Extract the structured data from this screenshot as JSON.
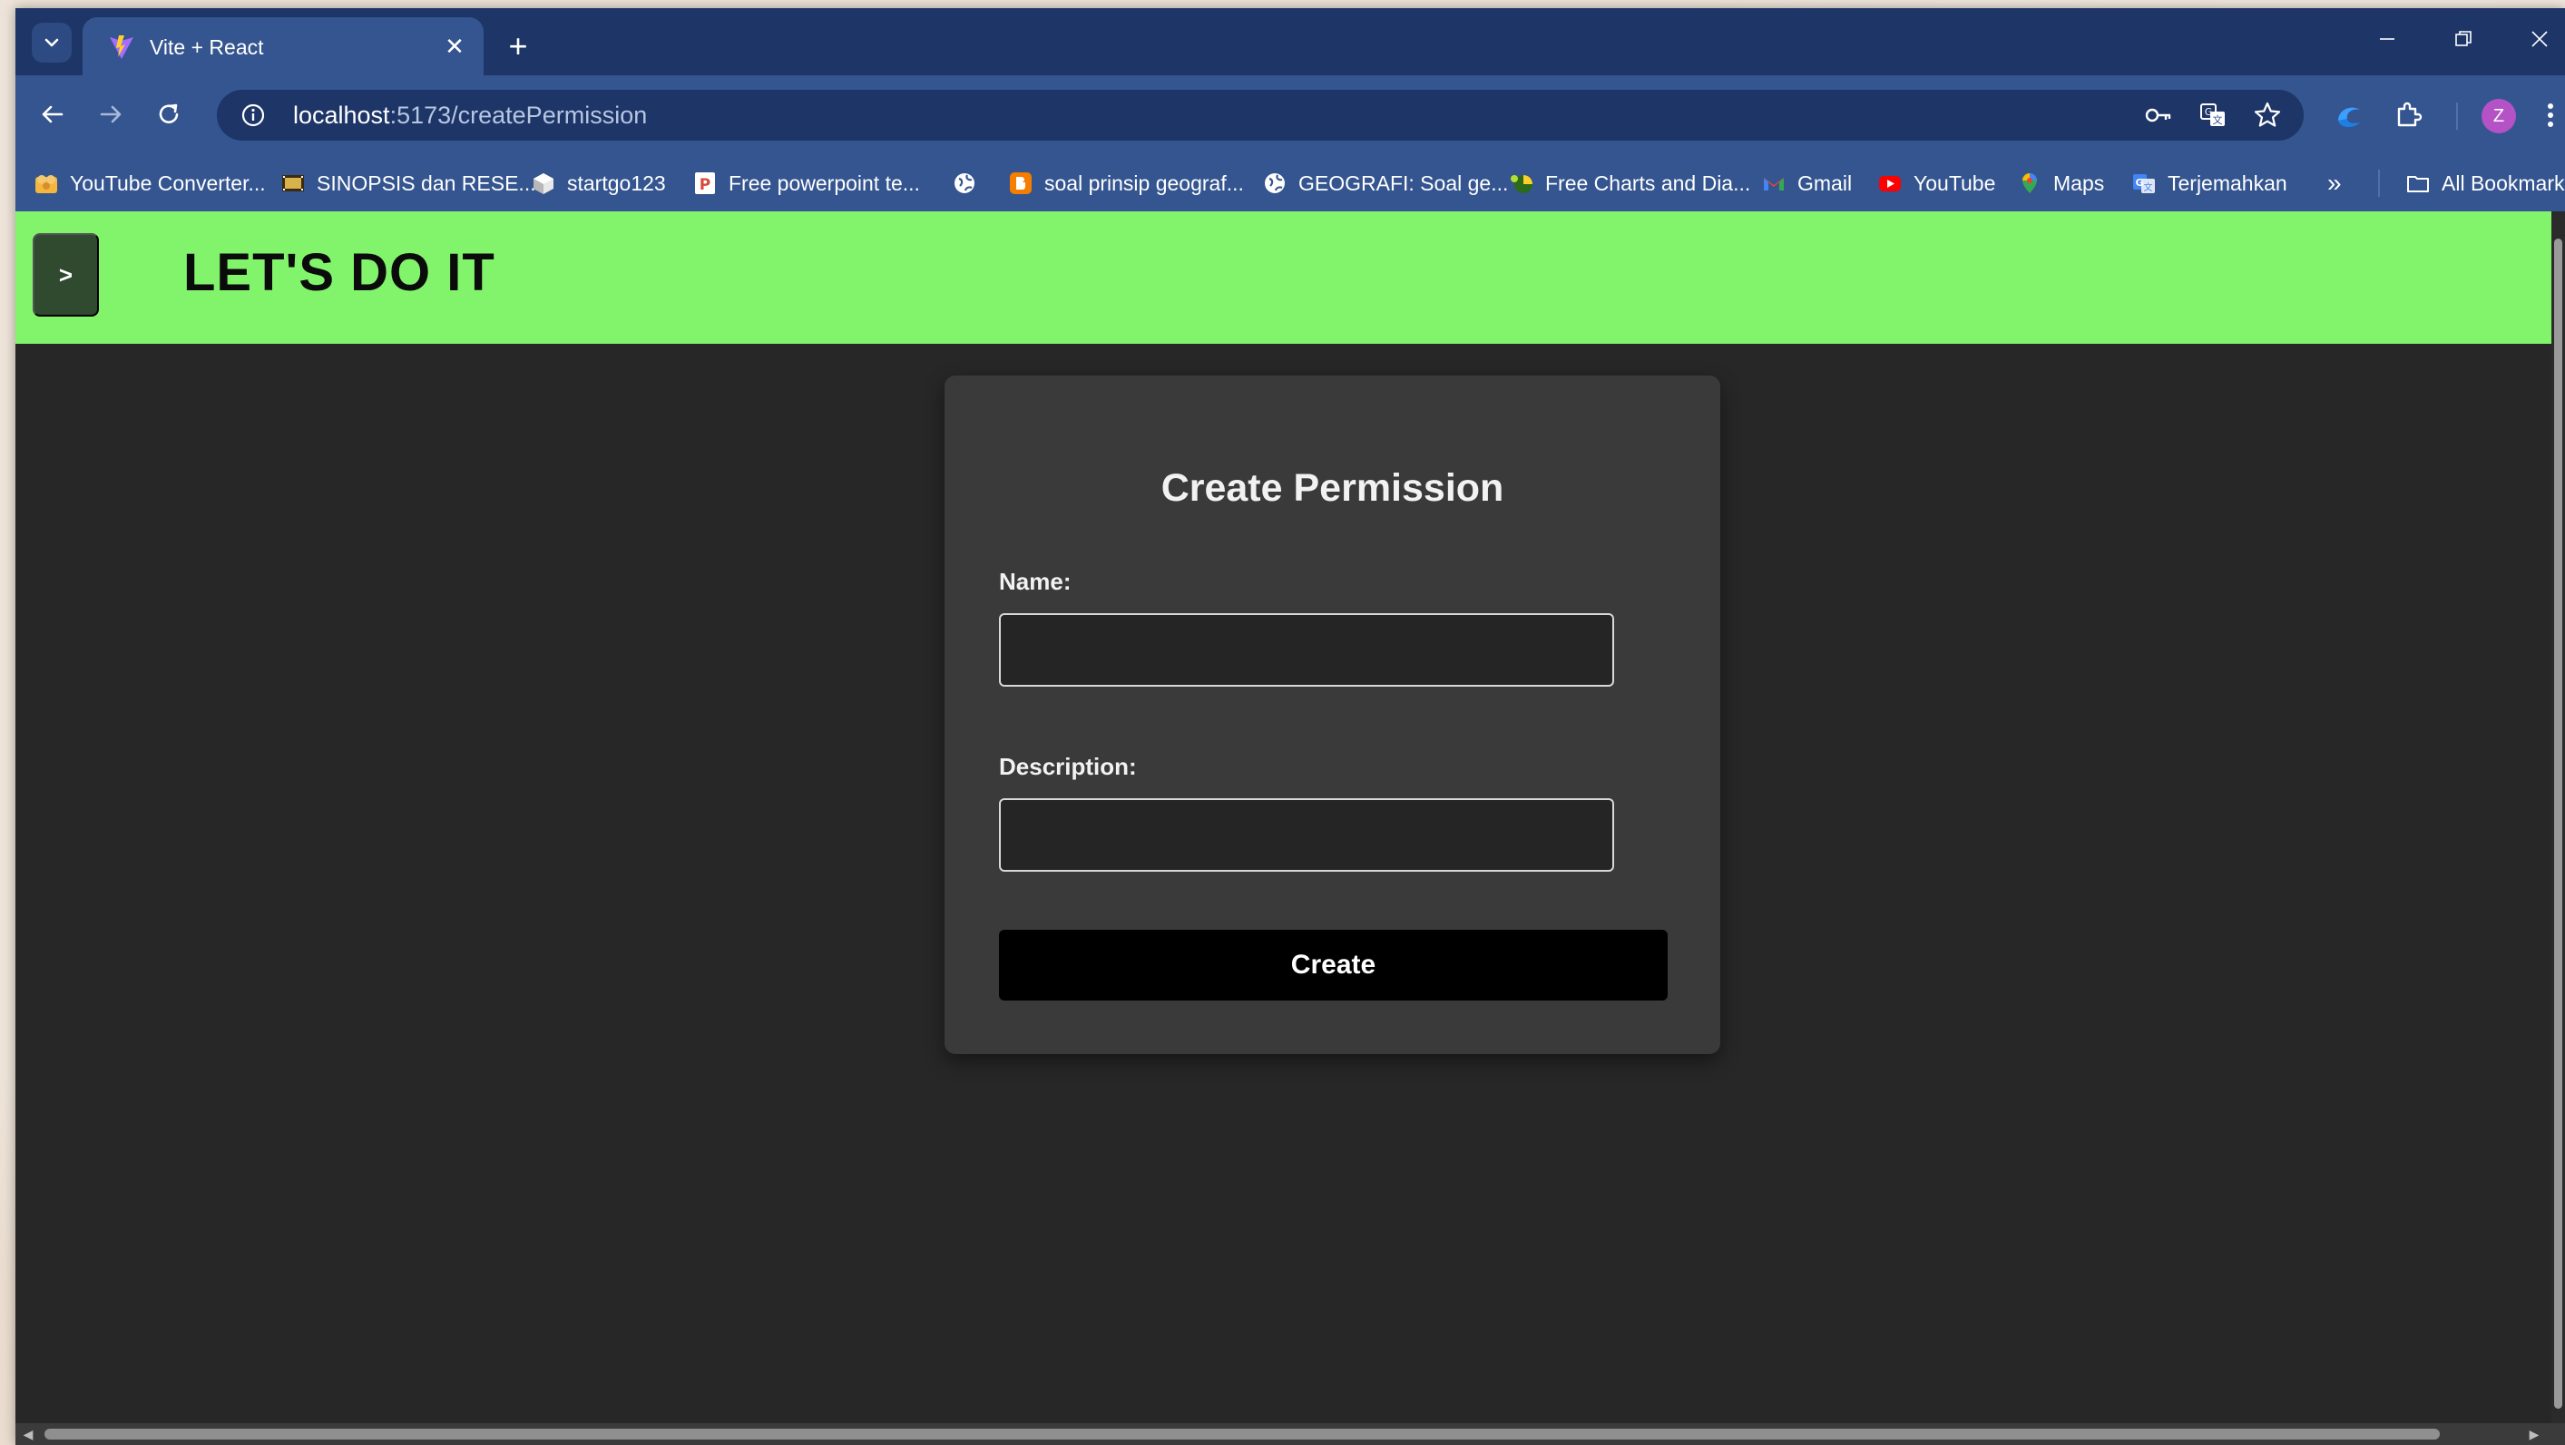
{
  "browser": {
    "tab_title": "Vite + React",
    "tab_close": "✕",
    "new_tab": "+",
    "url_host": "localhost",
    "url_path": ":5173/createPermission",
    "profile_initial": "Z"
  },
  "bookmarks": [
    {
      "label": "YouTube Converter...",
      "icon": "folder-character-icon"
    },
    {
      "label": "SINOPSIS dan RESE...",
      "icon": "film-icon"
    },
    {
      "label": "startgo123",
      "icon": "cube-icon"
    },
    {
      "label": "Free powerpoint te...",
      "icon": "powerpoint-icon"
    },
    {
      "label": "",
      "icon": "globe-icon"
    },
    {
      "label": "soal prinsip geograf...",
      "icon": "blogger-icon"
    },
    {
      "label": "GEOGRAFI: Soal ge...",
      "icon": "globe-icon"
    },
    {
      "label": "Free Charts and Dia...",
      "icon": "chart-icon"
    },
    {
      "label": "Gmail",
      "icon": "gmail-icon"
    },
    {
      "label": "YouTube",
      "icon": "youtube-icon"
    },
    {
      "label": "Maps",
      "icon": "maps-icon"
    },
    {
      "label": "Terjemahkan",
      "icon": "translate-icon"
    }
  ],
  "bookmarks_overflow": "»",
  "all_bookmarks": "All Bookmarks",
  "app": {
    "menu_button": ">",
    "title": "LET'S DO IT"
  },
  "form": {
    "title": "Create Permission",
    "name_label": "Name:",
    "name_value": "",
    "description_label": "Description:",
    "description_value": "",
    "submit_label": "Create"
  },
  "colors": {
    "header_bg": "#82f46c",
    "page_bg": "#272727",
    "card_bg": "#3a3a3a",
    "button_bg": "#000000",
    "browser_frame": "#34558f"
  }
}
